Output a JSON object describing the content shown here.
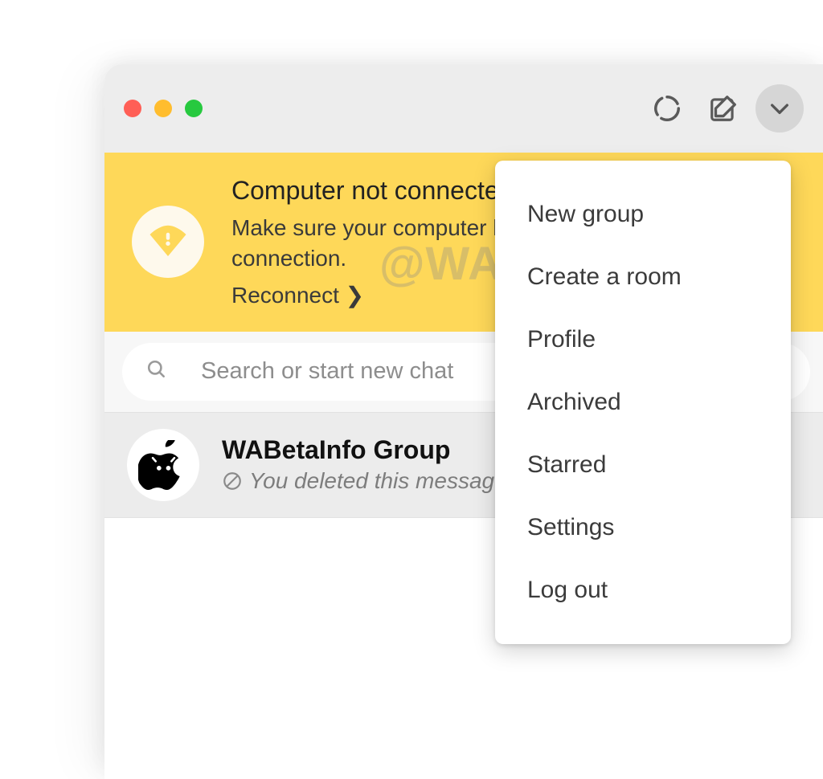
{
  "titlebar": {
    "icons": {
      "status": "status-icon",
      "compose": "compose-icon",
      "menu": "chevron-down-icon"
    }
  },
  "banner": {
    "title": "Computer not connected",
    "body": "Make sure your computer has an active Internet connection.",
    "link": "Reconnect ❯"
  },
  "search": {
    "placeholder": "Search or start new chat"
  },
  "chat": {
    "title": "WABetaInfo Group",
    "subtitle": "You deleted this message"
  },
  "menu": {
    "items": [
      "New group",
      "Create a room",
      "Profile",
      "Archived",
      "Starred",
      "Settings",
      "Log out"
    ]
  },
  "watermark": "@WABetaInfo"
}
